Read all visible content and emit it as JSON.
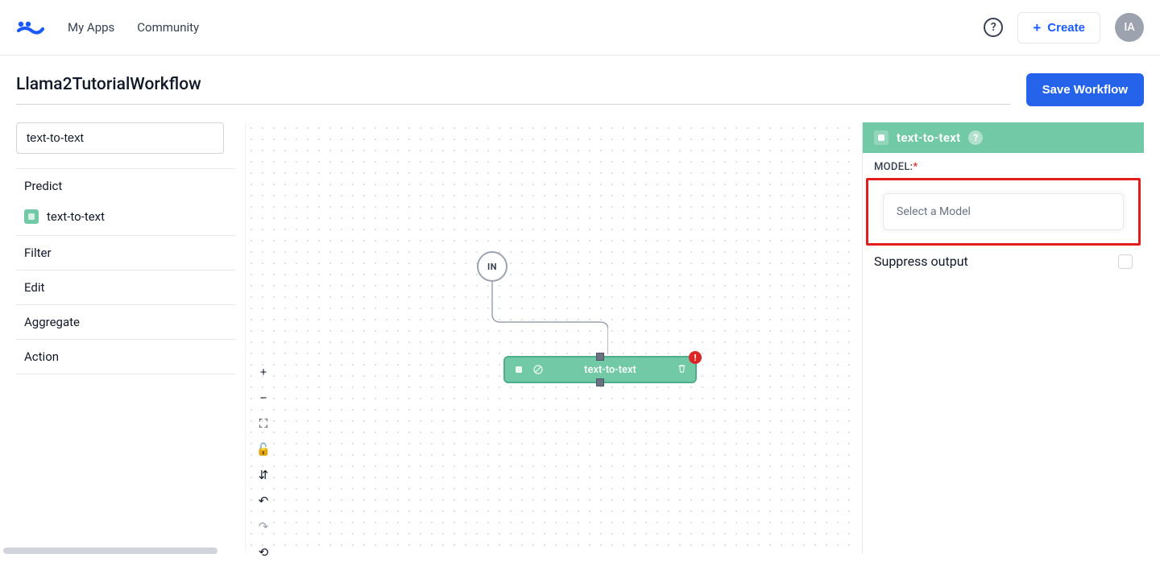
{
  "nav": {
    "my_apps": "My Apps",
    "community": "Community",
    "create": "Create",
    "avatar_initials": "IA",
    "help_glyph": "?"
  },
  "page": {
    "title": "Llama2TutorialWorkflow",
    "save": "Save Workflow"
  },
  "left": {
    "search_value": "text-to-text",
    "sections": {
      "predict": "Predict",
      "filter": "Filter",
      "edit": "Edit",
      "aggregate": "Aggregate",
      "action": "Action"
    },
    "predict_item": "text-to-text"
  },
  "canvas": {
    "in_label": "IN",
    "node_label": "text-to-text",
    "error_badge": "!"
  },
  "right": {
    "header_title": "text-to-text",
    "header_help": "?",
    "model_label": "MODEL:",
    "model_required": "*",
    "model_placeholder": "Select a Model",
    "suppress_label": "Suppress output"
  },
  "tools": {
    "zoom_in": "+",
    "zoom_out": "−",
    "fullscreen": "⛶",
    "lock": "🔓",
    "layout": "⇵",
    "undo": "↶",
    "redo": "↷",
    "refresh": "⟲"
  }
}
